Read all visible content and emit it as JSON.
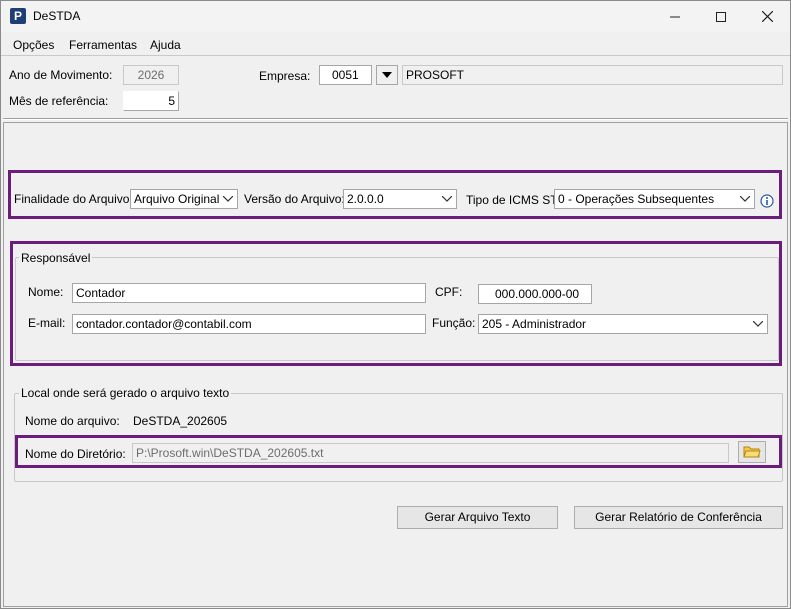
{
  "window": {
    "title": "DeSTDA"
  },
  "menu": [
    "Opções",
    "Ferramentas",
    "Ajuda"
  ],
  "header": {
    "ano_label": "Ano de Movimento:",
    "ano_value": "2026",
    "mes_label": "Mês de referência:",
    "mes_value": "5",
    "empresa_label": "Empresa:",
    "empresa_code": "0051",
    "empresa_name": "PROSOFT"
  },
  "arquivo": {
    "finalidade_label": "Finalidade do Arquivo:",
    "finalidade_value": "Arquivo Original",
    "versao_label": "Versão do Arquivo:",
    "versao_value": "2.0.0.0",
    "icms_label": "Tipo de ICMS ST:",
    "icms_value": "0 - Operações Subsequentes"
  },
  "responsavel": {
    "title": "Responsável",
    "nome_label": "Nome:",
    "nome_value": "Contador",
    "cpf_label": "CPF:",
    "cpf_value": "000.000.000-00",
    "email_label": "E-mail:",
    "email_value": "contador.contador@contabil.com",
    "funcao_label": "Função:",
    "funcao_value": "205 - Administrador"
  },
  "local": {
    "title": "Local onde será gerado o arquivo texto",
    "nome_arquivo_label": "Nome do arquivo:",
    "nome_arquivo_value": "DeSTDA_202605",
    "diretorio_label": "Nome do Diretório:",
    "diretorio_value": "P:\\Prosoft.win\\DeSTDA_202605.txt"
  },
  "actions": {
    "gerar_texto": "Gerar Arquivo Texto",
    "gerar_relatorio": "Gerar Relatório de Conferência"
  },
  "colors": {
    "highlight": "#6b1d7b",
    "app_icon": "#1d3f73"
  }
}
